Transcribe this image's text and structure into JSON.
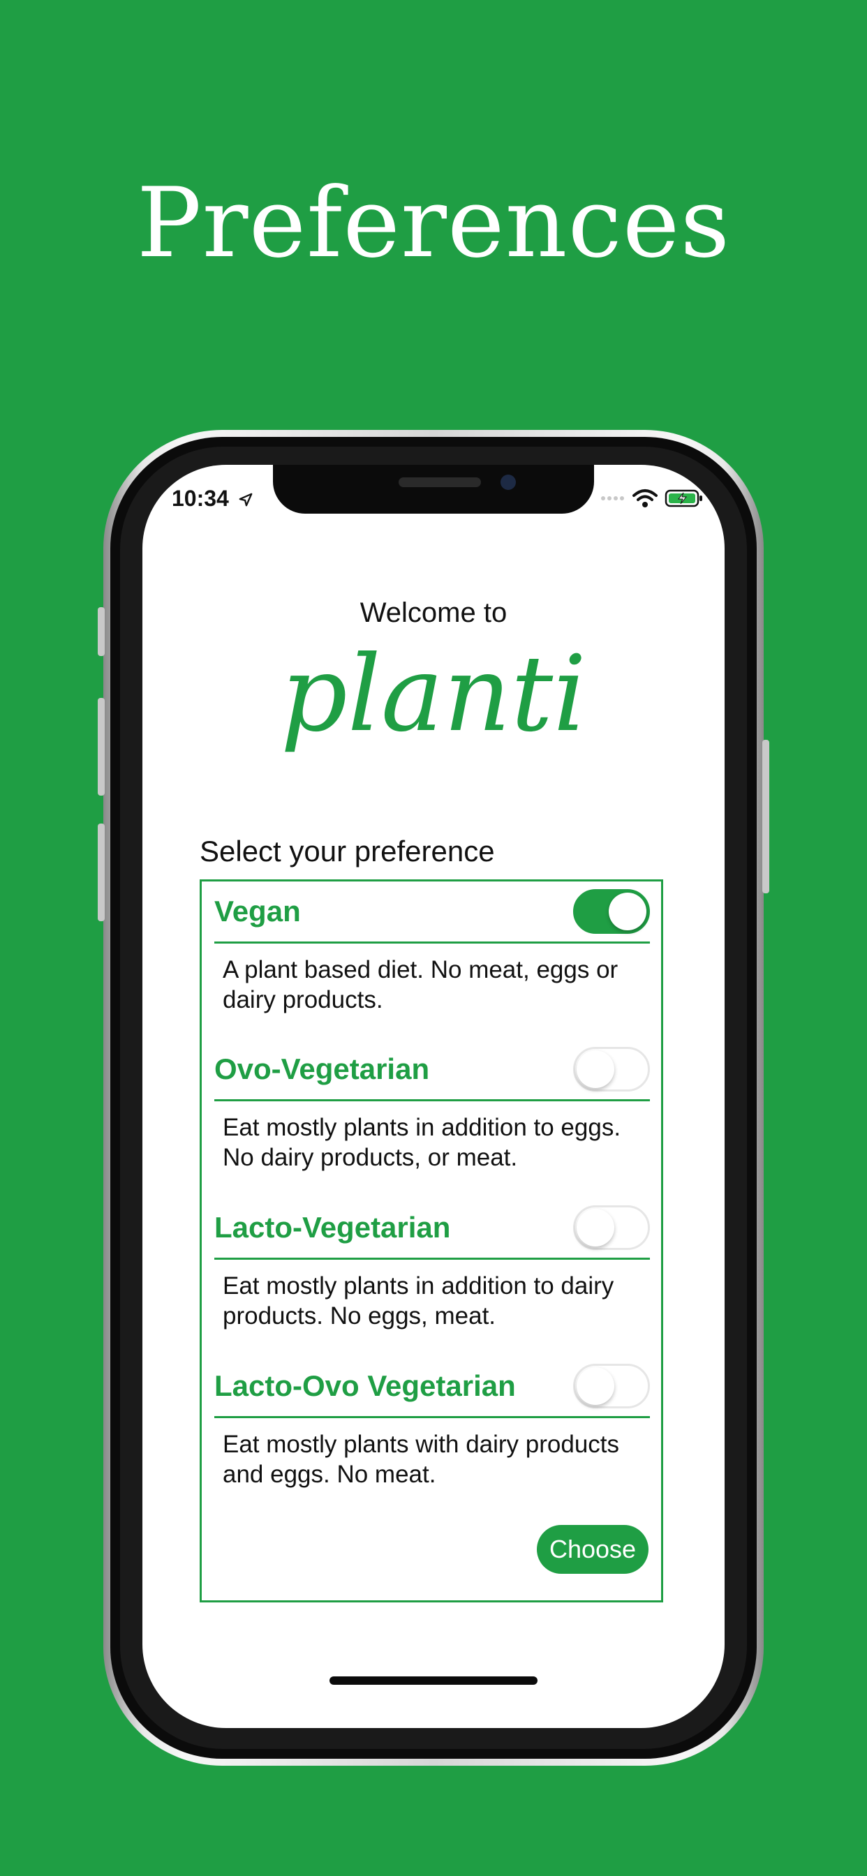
{
  "headline": "Preferences",
  "colors": {
    "brand_green": "#1f9e44",
    "background": "#1f9e44"
  },
  "status_bar": {
    "time": "10:34",
    "icons": [
      "location-arrow-icon",
      "signal-dots-icon",
      "wifi-icon",
      "battery-charging-icon"
    ]
  },
  "welcome": {
    "text": "Welcome to",
    "logo": "planti"
  },
  "preferences": {
    "label": "Select your preference",
    "options": [
      {
        "title": "Vegan",
        "description": "A plant based diet. No meat, eggs or dairy products.",
        "enabled": true
      },
      {
        "title": "Ovo-Vegetarian",
        "description": "Eat mostly plants in addition to eggs. No dairy products, or meat.",
        "enabled": false
      },
      {
        "title": "Lacto-Vegetarian",
        "description": "Eat mostly plants in addition to dairy products. No eggs, meat.",
        "enabled": false
      },
      {
        "title": "Lacto-Ovo Vegetarian",
        "description": "Eat mostly plants with dairy products and eggs. No meat.",
        "enabled": false
      }
    ],
    "choose_label": "Choose"
  }
}
